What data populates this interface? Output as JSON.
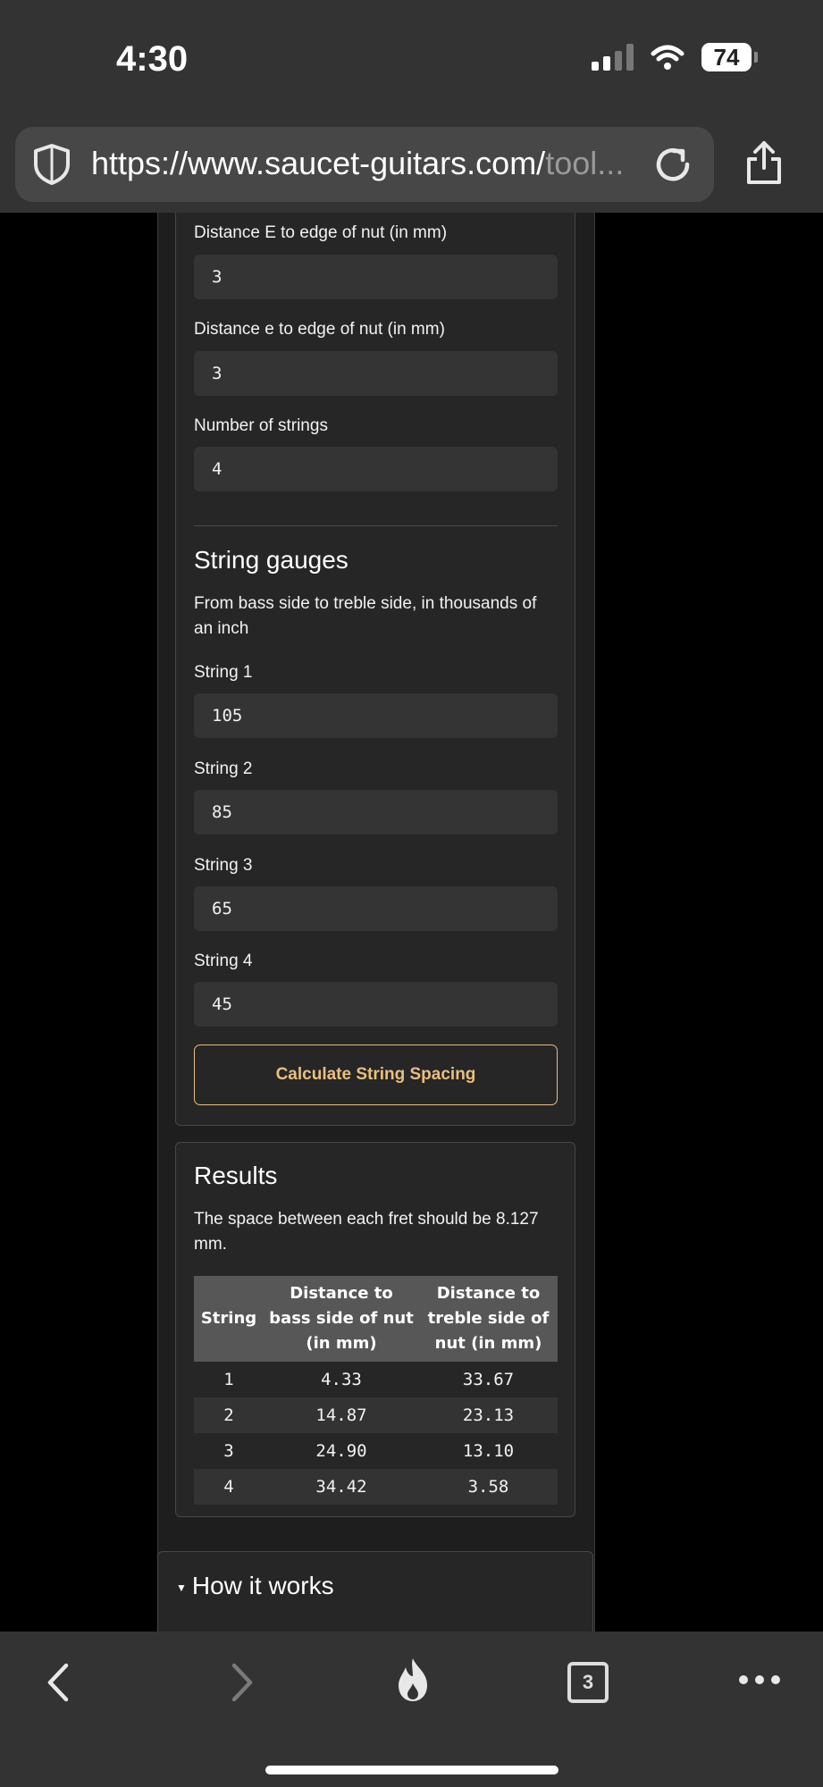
{
  "status_bar": {
    "time": "4:30",
    "battery": "74",
    "icons": [
      "signal-icon",
      "wifi-icon",
      "battery-icon"
    ]
  },
  "browser": {
    "url_main": "https://www.saucet-guitars.com/",
    "url_rest": "tool...",
    "icons": [
      "shield-icon",
      "reload-icon",
      "share-icon"
    ]
  },
  "form": {
    "distance_E_label": "Distance E to edge of nut (in mm)",
    "distance_E_value": "3",
    "distance_e_label": "Distance e to edge of nut (in mm)",
    "distance_e_value": "3",
    "num_strings_label": "Number of strings",
    "num_strings_value": "4"
  },
  "gauges": {
    "heading": "String gauges",
    "description": "From bass side to treble side, in thousands of an inch",
    "strings": [
      {
        "label": "String 1",
        "value": "105"
      },
      {
        "label": "String 2",
        "value": "85"
      },
      {
        "label": "String 3",
        "value": "65"
      },
      {
        "label": "String 4",
        "value": "45"
      }
    ],
    "button_label": "Calculate String Spacing"
  },
  "results": {
    "heading": "Results",
    "text": "The space between each fret should be 8.127 mm.",
    "columns": [
      "String",
      "Distance to bass side of nut (in mm)",
      "Distance to treble side of nut (in mm)"
    ],
    "rows": [
      [
        "1",
        "4.33",
        "33.67"
      ],
      [
        "2",
        "14.87",
        "23.13"
      ],
      [
        "3",
        "24.90",
        "13.10"
      ],
      [
        "4",
        "34.42",
        "3.58"
      ]
    ]
  },
  "how_it_works": {
    "summary": "How it works"
  },
  "toolbar": {
    "tab_count": "3",
    "icons": [
      "back-icon",
      "forward-icon",
      "flame-icon",
      "tabs-icon",
      "more-icon"
    ]
  }
}
